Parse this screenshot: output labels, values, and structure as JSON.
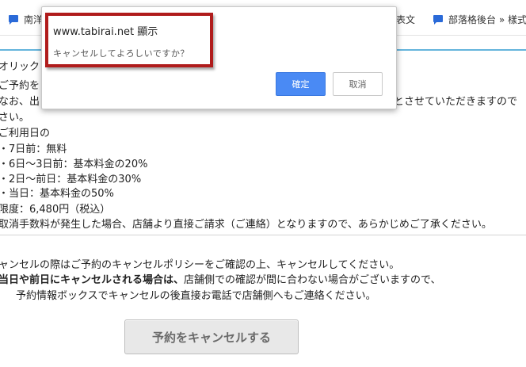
{
  "bookmarks": {
    "item1_label": "南洋",
    "item2_label": "表文",
    "item3_label": "部落格後台 » 樣式"
  },
  "dialog": {
    "title": "www.tabirai.net 顯示",
    "message": "キャンセルしてよろしいですか？",
    "ok_label": "確定",
    "cancel_label": "取消"
  },
  "policy": {
    "line1": "オリック",
    "line2": "ご予約を",
    "line3a": "なお、出",
    "line3b": "とさせていただきますので",
    "line4": "さい。",
    "line5": "ご利用日の",
    "line6": "・7日前：無料",
    "line7": "・6日〜3日前：基本料金の20%",
    "line8": "・2日〜前日：基本料金の30%",
    "line9": "・当日：基本料金の50%",
    "line10": "限度：6,480円（税込）",
    "line11": "取消手数料が発生した場合、店舗より直接ご請求（ご連絡）となりますので、あらかじめご了承ください。"
  },
  "notice": {
    "line1": "ャンセルの際はご予約のキャンセルポリシーをご確認の上、キャンセルしてください。",
    "line2_bold": "当日や前日にキャンセルされる場合は、",
    "line2_rest": "店舗側での確認が間に合わない場合がございますので、",
    "line3": "予約情報ボックスでキャンセルの後直接お電話で店舗側へもご連絡ください。"
  },
  "cancel_button_label": "予約をキャンセルする",
  "colors": {
    "accent_line": "#64b4dc",
    "ok_button": "#4a8af4",
    "highlight_box": "#b01c1c"
  },
  "icons": {
    "bookmark": "chat-bubble-icon"
  }
}
